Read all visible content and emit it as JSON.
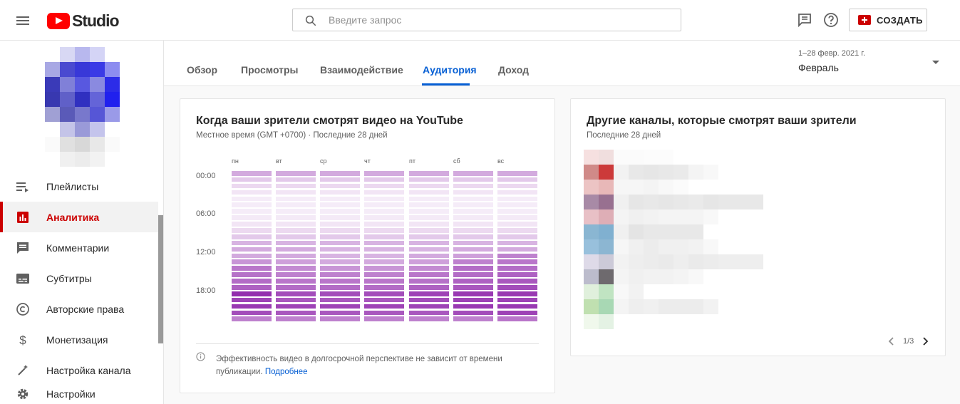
{
  "app": {
    "logo_text": "Studio",
    "search_placeholder": "Введите запрос",
    "create_label": "СОЗДАТЬ"
  },
  "sidebar": {
    "items": [
      {
        "label": "Плейлисты",
        "icon": "playlist-icon"
      },
      {
        "label": "Аналитика",
        "icon": "analytics-icon",
        "active": true
      },
      {
        "label": "Комментарии",
        "icon": "comments-icon"
      },
      {
        "label": "Субтитры",
        "icon": "subtitles-icon"
      },
      {
        "label": "Авторские права",
        "icon": "copyright-icon"
      },
      {
        "label": "Монетизация",
        "icon": "dollar-icon"
      },
      {
        "label": "Настройка канала",
        "icon": "customization-icon"
      },
      {
        "label": "Настройки",
        "icon": "gear-icon"
      }
    ]
  },
  "tabs": {
    "items": [
      "Обзор",
      "Просмотры",
      "Взаимодействие",
      "Аудитория",
      "Доход"
    ],
    "active": "Аудитория"
  },
  "period": {
    "range": "1–28 февр. 2021 г.",
    "name": "Февраль"
  },
  "when_card": {
    "title": "Когда ваши зрители смотрят видео на YouTube",
    "subtitle": "Местное время (GMT +0700) · Последние 28 дней",
    "days": [
      "пн",
      "вт",
      "ср",
      "чт",
      "пт",
      "сб",
      "вс"
    ],
    "times": [
      "00:00",
      "06:00",
      "12:00",
      "18:00"
    ],
    "info_text": "Эффективность видео в долгосрочной перспективе не зависит от времени публикации.",
    "info_link": "Подробнее"
  },
  "channels_card": {
    "title": "Другие каналы, которые смотрят ваши зрители",
    "subtitle": "Последние 28 дней",
    "page": "1/3"
  },
  "colors": {
    "accent": "#065fd4",
    "brand_red": "#ff0000",
    "active_red": "#cc0000",
    "heat_base": "#8e24aa"
  },
  "chart_data": {
    "type": "heatmap",
    "title": "Когда ваши зрители смотрят видео на YouTube",
    "x": [
      "пн",
      "вт",
      "ср",
      "чт",
      "пт",
      "сб",
      "вс"
    ],
    "y": [
      "00:00",
      "01:00",
      "02:00",
      "03:00",
      "04:00",
      "05:00",
      "06:00",
      "07:00",
      "08:00",
      "09:00",
      "10:00",
      "11:00",
      "12:00",
      "13:00",
      "14:00",
      "15:00",
      "16:00",
      "17:00",
      "18:00",
      "19:00",
      "20:00",
      "21:00",
      "22:00",
      "23:00"
    ],
    "values": [
      [
        0.35,
        0.35,
        0.35,
        0.35,
        0.35,
        0.35,
        0.35
      ],
      [
        0.2,
        0.2,
        0.2,
        0.2,
        0.2,
        0.2,
        0.2
      ],
      [
        0.12,
        0.12,
        0.12,
        0.12,
        0.12,
        0.12,
        0.12
      ],
      [
        0.06,
        0.06,
        0.06,
        0.06,
        0.06,
        0.06,
        0.06
      ],
      [
        0.03,
        0.03,
        0.03,
        0.03,
        0.03,
        0.03,
        0.03
      ],
      [
        0.03,
        0.03,
        0.03,
        0.03,
        0.03,
        0.03,
        0.03
      ],
      [
        0.03,
        0.03,
        0.03,
        0.03,
        0.03,
        0.03,
        0.03
      ],
      [
        0.04,
        0.04,
        0.04,
        0.04,
        0.04,
        0.04,
        0.04
      ],
      [
        0.06,
        0.06,
        0.06,
        0.06,
        0.06,
        0.06,
        0.06
      ],
      [
        0.12,
        0.12,
        0.12,
        0.12,
        0.12,
        0.12,
        0.12
      ],
      [
        0.2,
        0.2,
        0.2,
        0.2,
        0.2,
        0.2,
        0.2
      ],
      [
        0.3,
        0.3,
        0.3,
        0.3,
        0.3,
        0.3,
        0.3
      ],
      [
        0.35,
        0.35,
        0.3,
        0.3,
        0.3,
        0.35,
        0.35
      ],
      [
        0.35,
        0.35,
        0.3,
        0.3,
        0.35,
        0.4,
        0.55
      ],
      [
        0.45,
        0.4,
        0.35,
        0.35,
        0.4,
        0.55,
        0.6
      ],
      [
        0.6,
        0.5,
        0.45,
        0.45,
        0.5,
        0.65,
        0.65
      ],
      [
        0.62,
        0.55,
        0.55,
        0.55,
        0.6,
        0.65,
        0.7
      ],
      [
        0.65,
        0.6,
        0.6,
        0.6,
        0.62,
        0.7,
        0.75
      ],
      [
        0.7,
        0.65,
        0.65,
        0.65,
        0.7,
        0.75,
        0.8
      ],
      [
        0.95,
        0.8,
        0.8,
        0.8,
        0.85,
        0.9,
        0.9
      ],
      [
        0.85,
        0.75,
        0.75,
        0.75,
        0.8,
        0.85,
        0.85
      ],
      [
        0.9,
        0.85,
        0.85,
        0.85,
        0.85,
        0.9,
        0.9
      ],
      [
        0.8,
        0.75,
        0.75,
        0.75,
        0.75,
        0.8,
        0.85
      ],
      [
        0.55,
        0.55,
        0.55,
        0.55,
        0.55,
        0.55,
        0.6
      ]
    ]
  }
}
